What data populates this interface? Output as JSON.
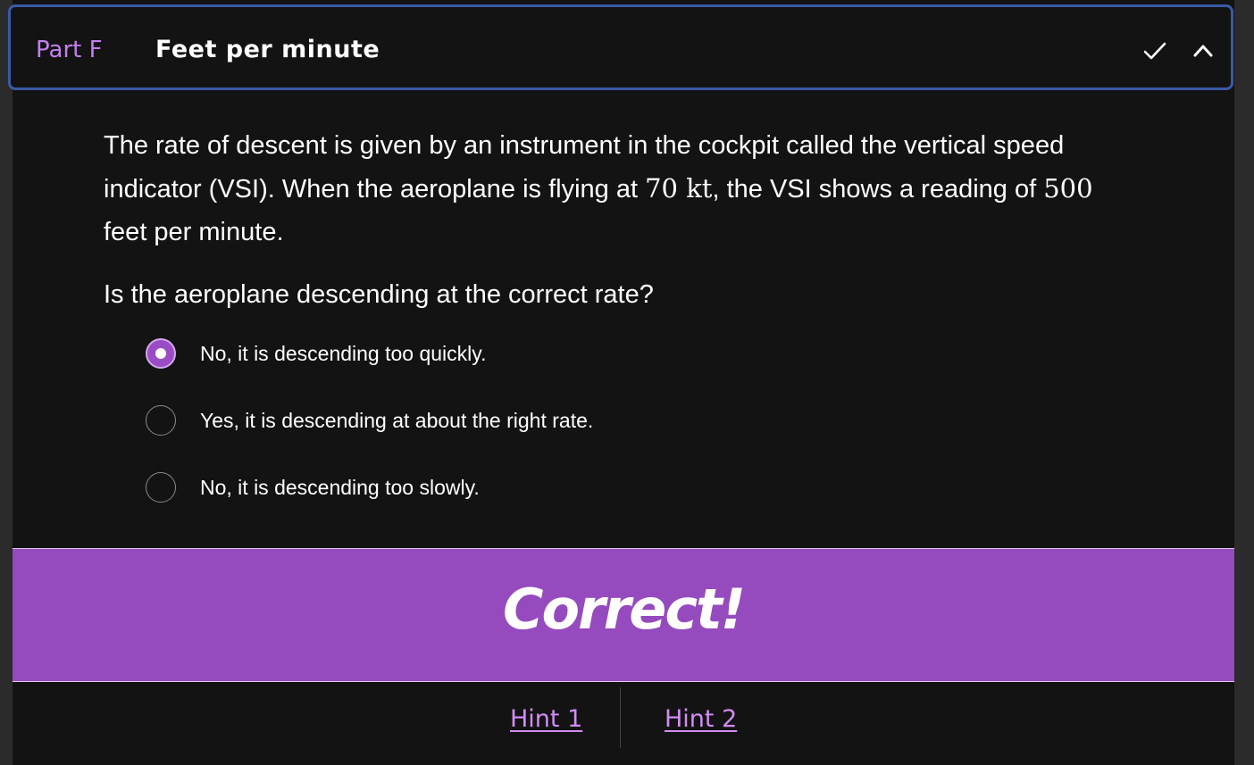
{
  "header": {
    "part_label": "Part F",
    "title": "Feet per minute",
    "icons": [
      "check-icon",
      "chevron-up-icon"
    ]
  },
  "question": {
    "text_1": "The rate of descent is given by an instrument in the cockpit called the vertical speed indicator (VSI). When the aeroplane is flying at ",
    "math_speed": "70 kt",
    "text_2": ", the VSI shows a reading of ",
    "math_reading": "500",
    "text_3": " feet per minute.",
    "prompt": "Is the aeroplane descending at the correct rate?"
  },
  "options": [
    {
      "label": "No, it is descending too quickly.",
      "selected": true
    },
    {
      "label": "Yes, it is descending at about the right rate.",
      "selected": false
    },
    {
      "label": "No, it is descending too slowly.",
      "selected": false
    }
  ],
  "feedback": {
    "text": "Correct!"
  },
  "hints": {
    "hint1": "Hint 1",
    "hint2": "Hint 2"
  },
  "colors": {
    "accent": "#954bbd",
    "link": "#d28cf5",
    "header_border": "#3a5aa6"
  }
}
